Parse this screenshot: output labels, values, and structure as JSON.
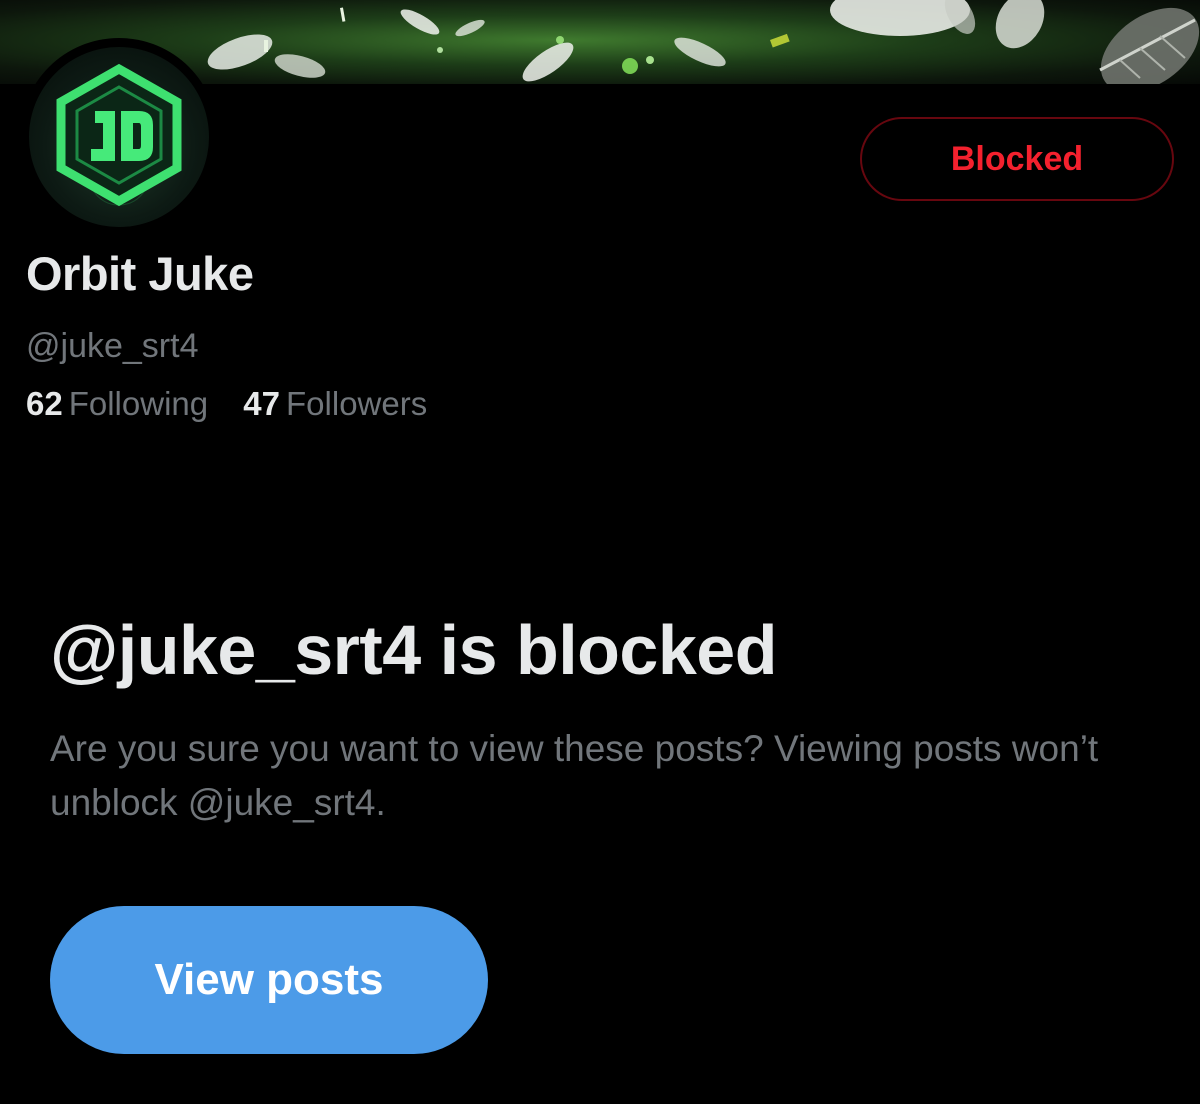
{
  "profile": {
    "display_name": "Orbit Juke",
    "handle": "@juke_srt4",
    "following_count": "62",
    "following_label": "Following",
    "followers_count": "47",
    "followers_label": "Followers",
    "avatar_icon": "jd-hexagon-logo"
  },
  "actions": {
    "blocked_label": "Blocked"
  },
  "blocked_notice": {
    "title": "@juke_srt4 is blocked",
    "description": "Are you sure you want to view these posts? Viewing posts won’t unblock @juke_srt4.",
    "button_label": "View posts"
  },
  "colors": {
    "background": "#000000",
    "primary_text": "#e7e9ea",
    "secondary_text": "#71767b",
    "blocked_red": "#f4212e",
    "blocked_border": "#67070f",
    "button_blue": "#4c9be8",
    "logo_green": "#39d66a"
  }
}
